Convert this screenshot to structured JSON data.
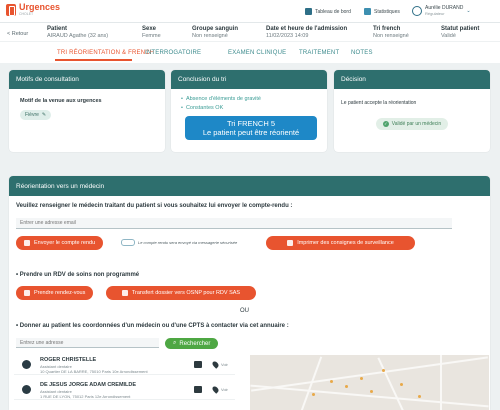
{
  "app": {
    "title": "Urgences",
    "subtitle": "CHOLET",
    "brand_color": "#e8542f",
    "accent_color": "#2e6f6e"
  },
  "toolbar": {
    "dashboard": "Tableau de bord",
    "stats": "Statistiques",
    "user_name": "Aurélie DURAND",
    "user_role": "Régulateur"
  },
  "back": "< Retour",
  "patient": {
    "h_patient": "Patient",
    "v_patient": "AIRAUD Agathe (32 ans)",
    "h_sexe": "Sexe",
    "v_sexe": "Femme",
    "h_groupe": "Groupe sanguin",
    "v_groupe": "Non renseigné",
    "h_date": "Date et heure de l'admission",
    "v_date": "11/02/2023 14:09",
    "h_tri": "Tri french",
    "v_tri": "Non renseigné",
    "h_statut": "Statut patient",
    "v_statut": "Validé"
  },
  "tabs": {
    "t1": "TRI RÉORIENTATION & FRENCH",
    "t2": "INTERROGATOIRE",
    "t3": "EXAMEN CLINIQUE",
    "t4": "TRAITEMENT",
    "t5": "NOTES"
  },
  "motifs": {
    "title": "Motifs de consultation",
    "label": "Motif de la venue aux urgences",
    "chip": "Fièvre"
  },
  "conclusion": {
    "title": "Conclusion du tri",
    "b1": "Absence d'éléments de gravité",
    "b2": "Constantes OK",
    "btn_l1": "Tri FRENCH 5",
    "btn_l2": "Le patient peut être réorienté"
  },
  "decision": {
    "title": "Décision",
    "text": "Le patient accepte la réorientation",
    "badge": "Validé par un médecin"
  },
  "reorient": {
    "title": "Réorientation vers un médecin",
    "q1": "Veuillez renseigner le médecin traitant du patient si vous souhaitez lui envoyer le compte-rendu :",
    "email_placeholder": "Entrer une adresse email",
    "send_btn": "Envoyer le compte rendu",
    "secure_note": "Le compte rendu sera envoyé via messagerie sécurisée",
    "print_btn": "Imprimer des consignes de surveillance",
    "q2": "Prendre un RDV de soins non programmé",
    "rdv_btn": "Prendre rendez-vous",
    "osnp_btn": "Transfert dossier vers OSNP pour RDV SAS",
    "ou": "OU",
    "q3": "Donner au patient les coordonnées d'un médecin ou d'une CPTS à contacter via cet annuaire :",
    "address_placeholder": "Entrez une adresse",
    "search_btn": "Rechercher"
  },
  "doctors": [
    {
      "name": "ROGER CHRISTELLE",
      "specialty": "Assistant dentaire",
      "address": "10 Quartier DE LA BARRE, 75010 Paris 10e Arrondissement",
      "view": "Voir"
    },
    {
      "name": "DE JESUS JORGE ADAM CREMILDE",
      "specialty": "Assistant dentaire",
      "address": "1 RUE DE LYON, 75012 Paris 12e Arrondissement",
      "view": "Voir"
    }
  ]
}
